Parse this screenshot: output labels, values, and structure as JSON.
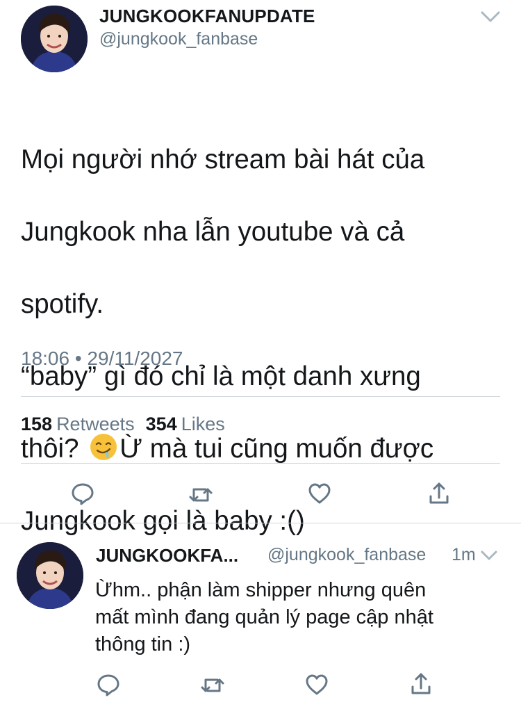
{
  "main_tweet": {
    "display_name": "JUNGKOOKFANUPDATE",
    "handle": "@jungkook_fanbase",
    "text_lines": [
      "Mọi người nhớ stream bài hát của",
      "Jungkook nha lẫn youtube và cả",
      "spotify.",
      "“baby” gì đó chỉ là một danh xưng",
      "thôi? ",
      "Ừ mà tui cũng muốn được",
      "Jungkook gọi là baby :()"
    ],
    "timestamp": "18:06 • 29/11/2027",
    "retweets_count": "158",
    "retweets_label": "Retweets",
    "likes_count": "354",
    "likes_label": "Likes"
  },
  "reply_tweet": {
    "display_name": "JUNGKOOKFA...",
    "handle": "@jungkook_fanbase",
    "time": "1m",
    "text_lines": [
      "Ừhm.. phận làm shipper nhưng quên",
      "mất mình đang quản lý page cập nhật",
      "thông tin :)"
    ]
  },
  "icons": {
    "reply": "reply-icon",
    "retweet": "retweet-icon",
    "like": "heart-icon",
    "share": "share-icon",
    "caret": "chevron-down-icon",
    "emoji": "drooling-face-emoji"
  },
  "colors": {
    "text": "#14171a",
    "secondary": "#657786",
    "icon": "#657786",
    "divider": "#cfd6db"
  }
}
